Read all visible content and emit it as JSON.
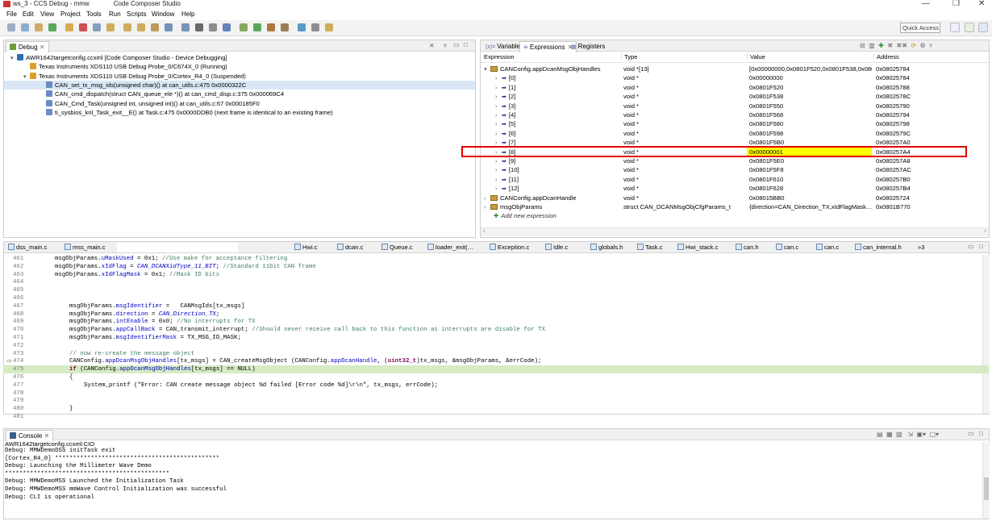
{
  "window": {
    "title_left": "ws_3 - CCS Debug - mmw",
    "title_right": "Code Composer Studio",
    "minimize": "—",
    "restore": "❐",
    "close": "✕"
  },
  "menu": [
    "File",
    "Edit",
    "View",
    "Project",
    "Tools",
    "Run",
    "Scripts",
    "Window",
    "Help"
  ],
  "toolbar": {
    "quick_access": "Quick Access"
  },
  "debug": {
    "tab_label": "Debug",
    "items": [
      {
        "text": "AWR1642targetconfig.ccxml [Code Composer Studio - Device Debugging]",
        "indent": 8,
        "tri": "▾",
        "icon": "#2d6fb3",
        "selected": false
      },
      {
        "text": "Texas Instruments XDS110 USB Debug Probe_0/C674X_0 (Running)",
        "indent": 24,
        "tri": "",
        "icon": "#d9a12b",
        "selected": false
      },
      {
        "text": "Texas Instruments XDS110 USB Debug Probe_0/Cortex_R4_0 (Suspended)",
        "indent": 24,
        "tri": "▾",
        "icon": "#d9a12b",
        "selected": false
      },
      {
        "text": "CAN_set_tx_msg_ids(unsigned char)() at can_utils.c:475 0x0000322C",
        "indent": 44,
        "tri": "",
        "icon": "#6b8cc5",
        "selected": true
      },
      {
        "text": "CAN_cmd_dispatch(struct CAN_queue_ele *)() at can_cmd_disp.c:375 0x000069C4",
        "indent": 44,
        "tri": "",
        "icon": "#6b8cc5",
        "selected": false
      },
      {
        "text": "CAN_Cmd_Task(unsigned int, unsigned int)() at can_utils.c:67 0x000185F0",
        "indent": 44,
        "tri": "",
        "icon": "#6b8cc5",
        "selected": false
      },
      {
        "text": "ti_sysbios_knl_Task_exit__E() at Task.c:475 0x0000DDB0  (next frame is identical to an existing frame)",
        "indent": 44,
        "tri": "",
        "icon": "#6b8cc5",
        "selected": false
      }
    ]
  },
  "expressions_panel": {
    "tabs": [
      {
        "label": "Variables",
        "active": false
      },
      {
        "label": "Expressions",
        "active": true
      },
      {
        "label": "Registers",
        "active": false
      }
    ],
    "columns": [
      "Expression",
      "Type",
      "Value",
      "Address"
    ],
    "rows": [
      {
        "indent": 0,
        "tri": "▾",
        "name": "CANConfig.appDcanMsgObjHandles",
        "type": "void *[13]",
        "value": "[0x00000000,0x0801F520,0x0801F538,0x0801…",
        "address": "0x08025784",
        "highlight": false
      },
      {
        "indent": 14,
        "tri": "›",
        "name": "[0]",
        "type": "void *",
        "value": "0x00000000",
        "address": "0x08025784",
        "highlight": false
      },
      {
        "indent": 14,
        "tri": "›",
        "name": "[1]",
        "type": "void *",
        "value": "0x0801F520",
        "address": "0x08025788",
        "highlight": false
      },
      {
        "indent": 14,
        "tri": "›",
        "name": "[2]",
        "type": "void *",
        "value": "0x0801F538",
        "address": "0x0802578C",
        "highlight": false
      },
      {
        "indent": 14,
        "tri": "›",
        "name": "[3]",
        "type": "void *",
        "value": "0x0801F550",
        "address": "0x08025790",
        "highlight": false
      },
      {
        "indent": 14,
        "tri": "›",
        "name": "[4]",
        "type": "void *",
        "value": "0x0801F568",
        "address": "0x08025794",
        "highlight": false
      },
      {
        "indent": 14,
        "tri": "›",
        "name": "[5]",
        "type": "void *",
        "value": "0x0801F580",
        "address": "0x08025798",
        "highlight": false
      },
      {
        "indent": 14,
        "tri": "›",
        "name": "[6]",
        "type": "void *",
        "value": "0x0801F598",
        "address": "0x0802579C",
        "highlight": false
      },
      {
        "indent": 14,
        "tri": "›",
        "name": "[7]",
        "type": "void *",
        "value": "0x0801F5B0",
        "address": "0x080257A0",
        "highlight": false
      },
      {
        "indent": 14,
        "tri": "›",
        "name": "[8]",
        "type": "void *",
        "value": "0x00000001",
        "address": "0x080257A4",
        "highlight": true
      },
      {
        "indent": 14,
        "tri": "›",
        "name": "[9]",
        "type": "void *",
        "value": "0x0801F5E0",
        "address": "0x080257A8",
        "highlight": false
      },
      {
        "indent": 14,
        "tri": "›",
        "name": "[10]",
        "type": "void *",
        "value": "0x0801F5F8",
        "address": "0x080257AC",
        "highlight": false
      },
      {
        "indent": 14,
        "tri": "›",
        "name": "[11]",
        "type": "void *",
        "value": "0x0801F610",
        "address": "0x080257B0",
        "highlight": false
      },
      {
        "indent": 14,
        "tri": "›",
        "name": "[12]",
        "type": "void *",
        "value": "0x0801F628",
        "address": "0x080257B4",
        "highlight": false
      },
      {
        "indent": 0,
        "tri": "›",
        "name": "CANConfig.appDcanHandle",
        "type": "void *",
        "value": "0x08015BB0",
        "address": "0x08025724",
        "highlight": false
      },
      {
        "indent": 0,
        "tri": "›",
        "name": "msgObjParams",
        "type": "struct CAN_DCANMsgObjCfgParams_t",
        "value": "{direction=CAN_Direction_TX,xIdFlagMask…",
        "address": "0x0801B770",
        "highlight": false
      }
    ],
    "add_new": "Add new expression"
  },
  "editor": {
    "tabs": [
      "dss_main.c",
      "mss_main.c",
      "Hwi.c",
      "dcan.c",
      "Queue.c",
      "loader_exit(…",
      "Exception.c",
      "Idle.c",
      "globals.h",
      "Task.c",
      "Hwi_stack.c",
      "can.h",
      "can.c",
      "can.c",
      "can_internal.h"
    ],
    "overflow": "»3",
    "lines": [
      {
        "n": "461",
        "indent": 0,
        "parts": [
          [
            "",
            "msgObjParams."
          ],
          [
            "fld",
            "uMaskUsed"
          ],
          [
            "",
            " = 0x1; "
          ],
          [
            "cm",
            "//Use make for acceptance filtering"
          ]
        ]
      },
      {
        "n": "462",
        "indent": 0,
        "parts": [
          [
            "",
            "msgObjParams."
          ],
          [
            "fld",
            "xIdFlag"
          ],
          [
            "",
            " = "
          ],
          [
            "it",
            "CAN_DCANXidType_11_BIT"
          ],
          [
            "",
            "; "
          ],
          [
            "cm",
            "//Standard 11bit CAN frame"
          ]
        ]
      },
      {
        "n": "463",
        "indent": 0,
        "parts": [
          [
            "",
            "msgObjParams."
          ],
          [
            "fld",
            "xIdFlagMask"
          ],
          [
            "",
            " = 0x1; "
          ],
          [
            "cm",
            "//Mask ID bits"
          ]
        ]
      },
      {
        "n": "464",
        "indent": 0,
        "parts": []
      },
      {
        "n": "465",
        "indent": 0,
        "parts": []
      },
      {
        "n": "466",
        "indent": 0,
        "parts": []
      },
      {
        "n": "467",
        "indent": 1,
        "parts": [
          [
            "",
            "msgObjParams."
          ],
          [
            "fld",
            "msgIdentifier"
          ],
          [
            "",
            " =   CANMsgIds[tx_msgs]"
          ]
        ]
      },
      {
        "n": "468",
        "indent": 1,
        "parts": [
          [
            "",
            "msgObjParams."
          ],
          [
            "fld",
            "direction"
          ],
          [
            "",
            " = "
          ],
          [
            "it",
            "CAN_Direction_TX"
          ],
          [
            "",
            ";"
          ]
        ]
      },
      {
        "n": "469",
        "indent": 1,
        "parts": [
          [
            "",
            "msgObjParams."
          ],
          [
            "fld",
            "intEnable"
          ],
          [
            "",
            " = 0x0; "
          ],
          [
            "cm",
            "//No interrupts for TX"
          ]
        ]
      },
      {
        "n": "470",
        "indent": 1,
        "parts": [
          [
            "",
            "msgObjParams."
          ],
          [
            "fld",
            "appCallBack"
          ],
          [
            "",
            " = CAN_transmit_interrupt; "
          ],
          [
            "cm",
            "//Should never receive call back to this function as interrupts are disable for TX"
          ]
        ]
      },
      {
        "n": "471",
        "indent": 1,
        "parts": [
          [
            "",
            "msgObjParams."
          ],
          [
            "fld",
            "msgIdentifierMask"
          ],
          [
            "",
            " = TX_MSG_ID_MASK;"
          ]
        ]
      },
      {
        "n": "472",
        "indent": 0,
        "parts": []
      },
      {
        "n": "473",
        "indent": 1,
        "parts": [
          [
            "cm",
            "// now re-create the message object"
          ]
        ]
      },
      {
        "n": "474",
        "indent": 1,
        "parts": [
          [
            "",
            "CANConfig."
          ],
          [
            "fld",
            "appDcanMsgObjHandles"
          ],
          [
            "",
            "[tx_msgs] = CAN_createMsgObject (CANConfig."
          ],
          [
            "fld",
            "appDcanHandle"
          ],
          [
            "",
            ", ("
          ],
          [
            "kw",
            "uint32_t"
          ],
          [
            "",
            ")tx_msgs, &msgObjParams, &errCode);"
          ]
        ]
      },
      {
        "n": "475",
        "indent": 1,
        "parts": [
          [
            "kw",
            "if"
          ],
          [
            "",
            " (CANConfig."
          ],
          [
            "fld",
            "appDcanMsgObjHandles"
          ],
          [
            "",
            "[tx_msgs] == NULL)"
          ]
        ],
        "current": true
      },
      {
        "n": "476",
        "indent": 1,
        "parts": [
          [
            "",
            "{"
          ]
        ]
      },
      {
        "n": "477",
        "indent": 2,
        "parts": [
          [
            "",
            "System_printf ("
          ],
          [
            "",
            "\"Error: CAN create message object %d failed [Error code %d]\\r\\n\""
          ],
          [
            "",
            ", tx_msgs, errCode);"
          ]
        ]
      },
      {
        "n": "478",
        "indent": 0,
        "parts": []
      },
      {
        "n": "479",
        "indent": 0,
        "parts": []
      },
      {
        "n": "480",
        "indent": 1,
        "parts": [
          [
            "",
            "}"
          ]
        ]
      },
      {
        "n": "481",
        "indent": 0,
        "parts": []
      }
    ]
  },
  "console": {
    "tab_label": "Console",
    "header": "AWR1642targetconfig.ccxml:CIO",
    "lines": [
      "Debug: MMWDemoDSS initTask exit",
      "[Cortex_R4_0] **********************************************",
      "Debug: Launching the Millimeter Wave Demo",
      "**********************************************",
      "Debug: MMWDemoMSS Launched the Initialization Task",
      "Debug: MMWDemoMSS mmWave Control Initialization was successful",
      "Debug: CLI is operational"
    ]
  },
  "colors": {
    "highlight_row_value": "#ffff00",
    "annotation_box": "#e00000",
    "current_line": "#d5ebc4",
    "selection": "#d9e6f5"
  }
}
